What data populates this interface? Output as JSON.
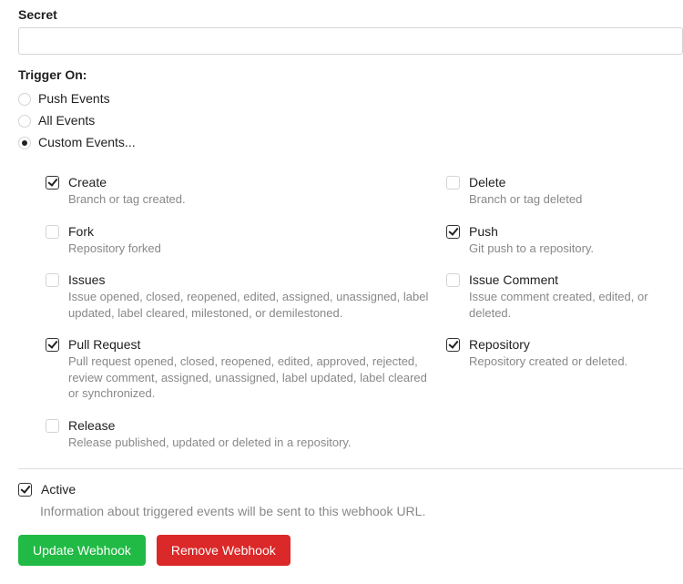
{
  "secret": {
    "label": "Secret",
    "value": ""
  },
  "trigger": {
    "label": "Trigger On:",
    "options": [
      {
        "label": "Push Events",
        "checked": false
      },
      {
        "label": "All Events",
        "checked": false
      },
      {
        "label": "Custom Events...",
        "checked": true
      }
    ]
  },
  "events": [
    {
      "title": "Create",
      "desc": "Branch or tag created.",
      "checked": true
    },
    {
      "title": "Delete",
      "desc": "Branch or tag deleted",
      "checked": false
    },
    {
      "title": "Fork",
      "desc": "Repository forked",
      "checked": false
    },
    {
      "title": "Push",
      "desc": "Git push to a repository.",
      "checked": true
    },
    {
      "title": "Issues",
      "desc": "Issue opened, closed, reopened, edited, assigned, unassigned, label updated, label cleared, milestoned, or demilestoned.",
      "checked": false
    },
    {
      "title": "Issue Comment",
      "desc": "Issue comment created, edited, or deleted.",
      "checked": false
    },
    {
      "title": "Pull Request",
      "desc": "Pull request opened, closed, reopened, edited, approved, rejected, review comment, assigned, unassigned, label updated, label cleared or synchronized.",
      "checked": true
    },
    {
      "title": "Repository",
      "desc": "Repository created or deleted.",
      "checked": true
    },
    {
      "title": "Release",
      "desc": "Release published, updated or deleted in a repository.",
      "checked": false
    }
  ],
  "active": {
    "label": "Active",
    "checked": true,
    "desc": "Information about triggered events will be sent to this webhook URL."
  },
  "buttons": {
    "update": "Update Webhook",
    "remove": "Remove Webhook"
  }
}
